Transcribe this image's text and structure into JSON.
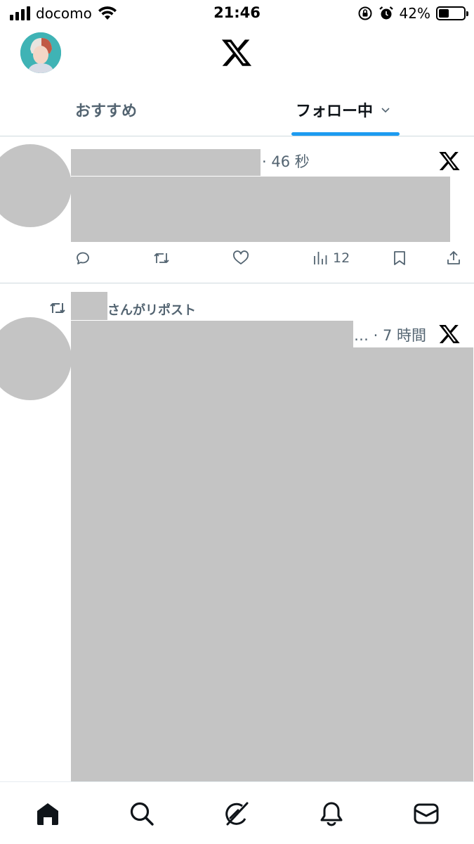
{
  "status_bar": {
    "carrier": "docomo",
    "time": "21:46",
    "battery_percent": "42%",
    "battery_level": 0.42
  },
  "header": {
    "logo": "x-logo-icon"
  },
  "tabs": [
    {
      "label": "おすすめ",
      "active": false
    },
    {
      "label": "フォロー中",
      "active": true
    }
  ],
  "posts": [
    {
      "time": "· 46 秒",
      "actions": {
        "reply": "",
        "repost": "",
        "like": "",
        "views": "12",
        "bookmark": "",
        "share": ""
      }
    },
    {
      "repost_by": "さんがリポスト",
      "time": "… · 7 時間"
    }
  ],
  "bottom_nav": [
    "home-icon",
    "search-icon",
    "grok-icon",
    "bell-icon",
    "mail-icon"
  ],
  "colors": {
    "accent": "#1d9bf0",
    "redaction": "#c4c4c4",
    "secondary_text": "#536471"
  }
}
